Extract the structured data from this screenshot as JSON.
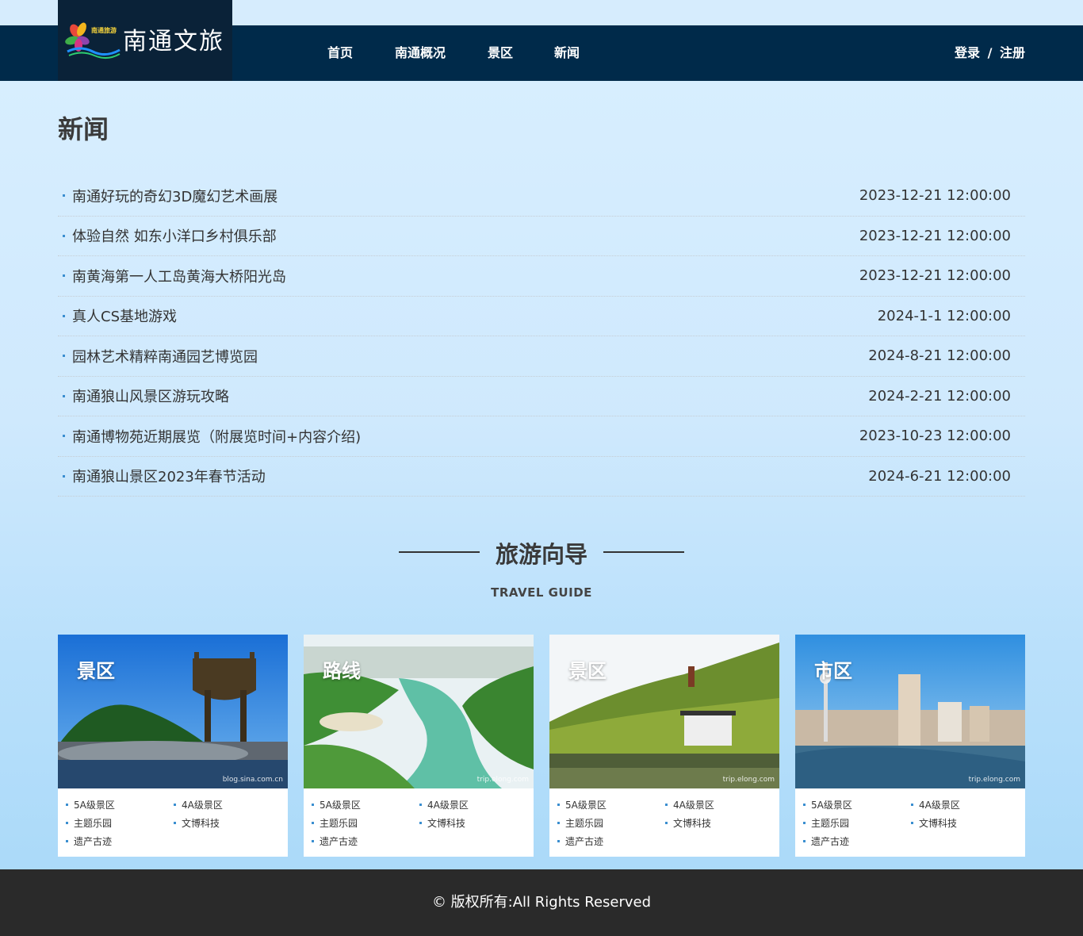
{
  "brand": {
    "name": "南通文旅",
    "logo_alt": "南通旅游"
  },
  "nav": {
    "items": [
      "首页",
      "南通概况",
      "景区",
      "新闻"
    ],
    "login": "登录",
    "divider": "/",
    "register": "注册"
  },
  "page_title": "新闻",
  "news": [
    {
      "title": "南通好玩的奇幻3D魔幻艺术画展",
      "date": "2023-12-21 12:00:00"
    },
    {
      "title": "体验自然 如东小洋口乡村俱乐部",
      "date": "2023-12-21 12:00:00"
    },
    {
      "title": "南黄海第一人工岛黄海大桥阳光岛",
      "date": "2023-12-21 12:00:00"
    },
    {
      "title": "真人CS基地游戏",
      "date": "2024-1-1 12:00:00"
    },
    {
      "title": "园林艺术精粹南通园艺博览园",
      "date": "2024-8-21 12:00:00"
    },
    {
      "title": "南通狼山风景区游玩攻略",
      "date": "2024-2-21 12:00:00"
    },
    {
      "title": "南通博物苑近期展览（附展览时间+内容介绍)",
      "date": "2023-10-23 12:00:00"
    },
    {
      "title": "南通狼山景区2023年春节活动",
      "date": "2024-6-21 12:00:00"
    }
  ],
  "guide": {
    "title_cn": "旅游向导",
    "title_en": "TRAVEL GUIDE",
    "cards": [
      {
        "tag": "景区",
        "watermark": "blog.sina.com.cn",
        "links": [
          "5A级景区",
          "4A级景区",
          "主题乐园",
          "文博科技",
          "遗产古迹"
        ]
      },
      {
        "tag": "路线",
        "watermark": "trip.elong.com",
        "links": [
          "5A级景区",
          "4A级景区",
          "主题乐园",
          "文博科技",
          "遗产古迹"
        ]
      },
      {
        "tag": "景区",
        "watermark": "trip.elong.com",
        "links": [
          "5A级景区",
          "4A级景区",
          "主题乐园",
          "文博科技",
          "遗产古迹"
        ]
      },
      {
        "tag": "市区",
        "watermark": "trip.elong.com",
        "links": [
          "5A级景区",
          "4A级景区",
          "主题乐园",
          "文博科技",
          "遗产古迹"
        ]
      }
    ]
  },
  "footer": "© 版权所有:All Rights Reserved"
}
